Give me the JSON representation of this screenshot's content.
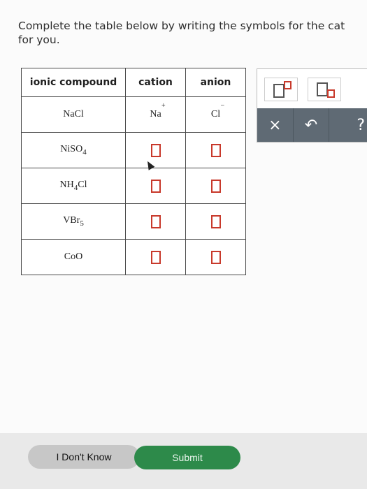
{
  "instructions": "Complete the table below by writing the symbols for the cat\nfor you.",
  "table": {
    "headers": [
      "ionic compound",
      "cation",
      "anion"
    ],
    "rows": [
      {
        "compound": "NaCl",
        "cation_symbol": "Na",
        "cation_charge": "+",
        "anion_symbol": "Cl",
        "anion_charge": "−"
      },
      {
        "compound_base": "NiSO",
        "compound_sub": "4"
      },
      {
        "compound_base": "NH",
        "compound_sub": "4",
        "compound_tail": "Cl"
      },
      {
        "compound_base": "VBr",
        "compound_sub": "5"
      },
      {
        "compound": "CoO"
      }
    ]
  },
  "toolbar": {
    "superscript_icon": "superscript-box-icon",
    "subscript_icon": "subscript-box-icon",
    "clear_label": "×",
    "undo_label": "↶",
    "help_label": "?"
  },
  "buttons": {
    "dont_know": "I Don't Know",
    "submit": "Submit"
  }
}
